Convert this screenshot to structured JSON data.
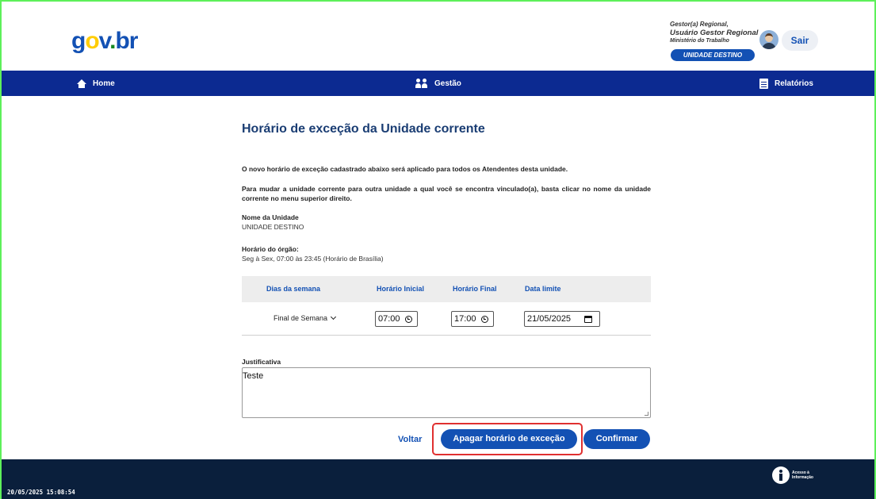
{
  "header": {
    "logo": {
      "g": "g",
      "o": "o",
      "v": "v",
      "dot": ".",
      "br": "br"
    },
    "user_role": "Gestor(a) Regional,",
    "user_name": "Usuário Gestor Regional",
    "user_org": "Ministério do Trabalho",
    "unit_button": "UNIDADE DESTINO",
    "logout_label": "Sair"
  },
  "nav": {
    "home": "Home",
    "gestao": "Gestão",
    "relatorios": "Relatórios"
  },
  "main": {
    "title": "Horário de exceção da Unidade corrente",
    "notice": "O novo horário de exceção cadastrado abaixo será aplicado para todos os Atendentes desta unidade.",
    "instructions": "Para mudar a unidade corrente para outra unidade a qual você se encontra vinculado(a), basta clicar no nome da unidade corrente no menu superior direito.",
    "unit_label": "Nome da Unidade",
    "unit_value": "UNIDADE DESTINO",
    "hours_label": "Horário do órgão:",
    "hours_value": "Seg à Sex, 07:00 às 23:45 (Horário de Brasília)"
  },
  "table": {
    "columns": [
      "Dias da semana",
      "Horário Inicial",
      "Horário Final",
      "Data limite"
    ],
    "row": {
      "days": "Final de Semana",
      "start": "07:00",
      "end": "17:00",
      "date": "21/05/2025"
    }
  },
  "justification": {
    "label": "Justificativa",
    "value": "Teste"
  },
  "actions": {
    "back": "Voltar",
    "delete": "Apagar horário de exceção",
    "confirm": "Confirmar"
  },
  "footer": {
    "timestamp": "20/05/2025 15:08:54",
    "acesso_line1": "Acesso à",
    "acesso_line2": "Informação"
  },
  "colors": {
    "primary": "#1351b4",
    "nav": "#0c2a91",
    "footer": "#0a1f3c",
    "highlight": "#e03030"
  }
}
